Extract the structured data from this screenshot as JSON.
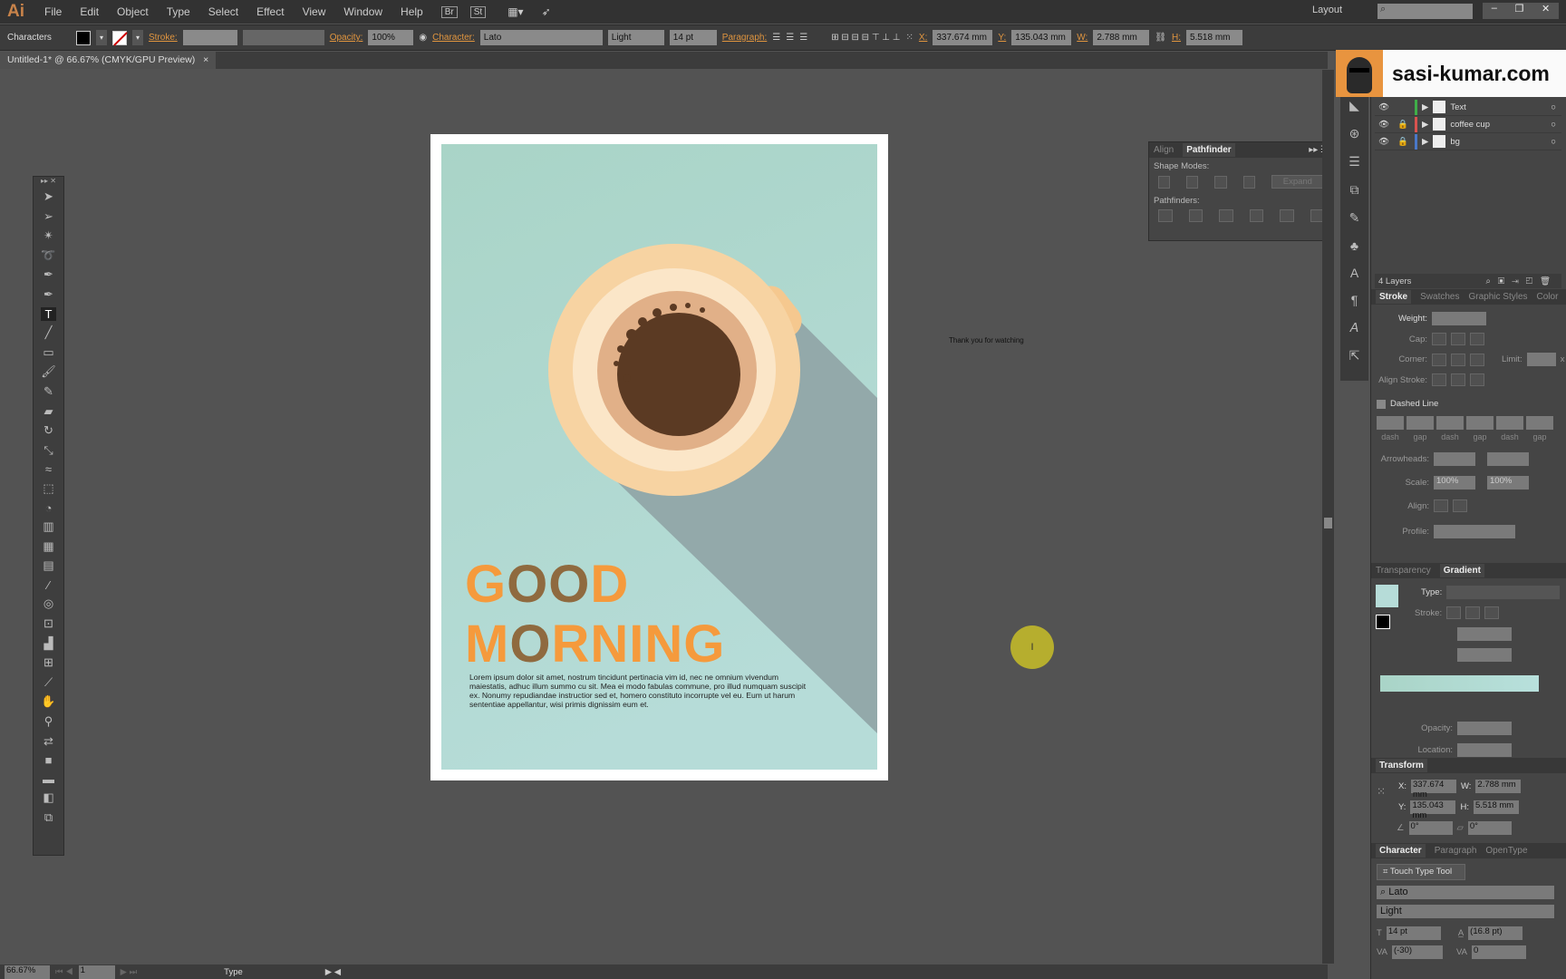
{
  "app": {
    "logo": "Ai",
    "menu": [
      "File",
      "Edit",
      "Object",
      "Type",
      "Select",
      "Effect",
      "View",
      "Window",
      "Help"
    ],
    "bridge": "Br",
    "stock": "St",
    "workspace": "Layout",
    "search_placeholder": ""
  },
  "control": {
    "selection": "Characters",
    "stroke_label": "Stroke:",
    "opacity_label": "Opacity:",
    "opacity": "100%",
    "character_label": "Character:",
    "font": "Lato",
    "style": "Light",
    "size": "14 pt",
    "paragraph_label": "Paragraph:",
    "x_label": "X:",
    "x": "337.674 mm",
    "y_label": "Y:",
    "y": "135.043 mm",
    "w_label": "W:",
    "w": "2.788 mm",
    "h_label": "H:",
    "h": "5.518 mm"
  },
  "document": {
    "tab": "Untitled-1* @ 66.67% (CMYK/GPU Preview)",
    "close": "×"
  },
  "artwork": {
    "title_line1": [
      "G",
      "OO",
      "D"
    ],
    "title_line2": [
      "M",
      "O",
      "RNING"
    ],
    "body": "Lorem ipsum dolor sit amet, nostrum tincidunt pertinacia vim id, nec ne omnium vivendum maiestatis, adhuc illum summo cu sit. Mea ei modo fabulas commune, pro illud numquam suscipit ex. Nonumy repudiandae instructior sed et, homero constituto incorrupte vel eu. Eum ut harum sententiae appellantur, wisi primis dignissim eum et.",
    "colors": {
      "bg": "#b6dcd8",
      "orange": "#f59a3c",
      "brown": "#8f6a3f",
      "saucer": "#f7d3a2",
      "coffee": "#5b3a23",
      "shadow": "#93a9aa"
    }
  },
  "canvas_note": "Thank you for watching",
  "watermark": "sasi-kumar.com",
  "pathfinder": {
    "tabs": [
      "Align",
      "Pathfinder"
    ],
    "shape_modes": "Shape Modes:",
    "expand": "Expand",
    "pathfinders": "Pathfinders:"
  },
  "layers": {
    "items": [
      {
        "name": "Text",
        "color": "#3fae49",
        "locked": false
      },
      {
        "name": "coffee cup",
        "color": "#d9534f",
        "locked": true
      },
      {
        "name": "bg",
        "color": "#4a78c8",
        "locked": true
      }
    ],
    "count": "4 Layers"
  },
  "stroke": {
    "tabs": [
      "Stroke",
      "Swatches",
      "Graphic Styles",
      "Color"
    ],
    "weight": "Weight:",
    "cap": "Cap:",
    "corner": "Corner:",
    "limit": "Limit:",
    "limit_unit": "x",
    "align_stroke": "Align Stroke:",
    "dashed": "Dashed Line",
    "dash_labels": [
      "dash",
      "gap",
      "dash",
      "gap",
      "dash",
      "gap"
    ],
    "arrowheads": "Arrowheads:",
    "scale": "Scale:",
    "scale1": "100%",
    "scale2": "100%",
    "align": "Align:",
    "profile": "Profile:"
  },
  "gradient": {
    "tabs": [
      "Transparency",
      "Gradient"
    ],
    "type": "Type:",
    "stroke": "Stroke:",
    "opacity": "Opacity:",
    "location": "Location:"
  },
  "transform": {
    "title": "Transform",
    "x_label": "X:",
    "x": "337.674 mm",
    "y_label": "Y:",
    "y": "135.043 mm",
    "w_label": "W:",
    "w": "2.788 mm",
    "h_label": "H:",
    "h": "5.518 mm",
    "angle": "0°",
    "shear": "0°"
  },
  "character": {
    "tabs": [
      "Character",
      "Paragraph",
      "OpenType"
    ],
    "touch_type": "Touch Type Tool",
    "font": "Lato",
    "style": "Light",
    "size": "14 pt",
    "leading": "(16.8 pt)",
    "kerning": "(-30)",
    "tracking": "0"
  },
  "status": {
    "zoom": "66.67%",
    "artboard": "1",
    "tool": "Type"
  }
}
